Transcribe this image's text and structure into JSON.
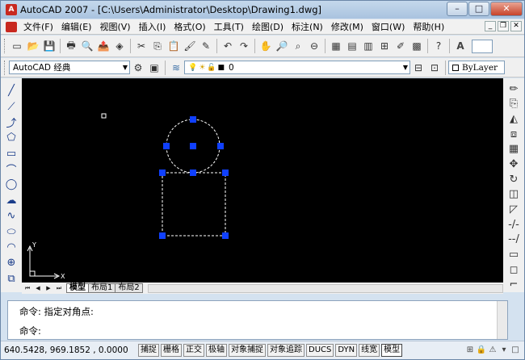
{
  "window": {
    "title": "AutoCAD 2007 - [C:\\Users\\Administrator\\Desktop\\Drawing1.dwg]",
    "app_icon": "autocad-logo-icon",
    "minimize": "–",
    "maximize": "□",
    "close": "✕"
  },
  "menu": {
    "items": [
      "文件(F)",
      "编辑(E)",
      "视图(V)",
      "插入(I)",
      "格式(O)",
      "工具(T)",
      "绘图(D)",
      "标注(N)",
      "修改(M)",
      "窗口(W)",
      "帮助(H)"
    ],
    "mdi_buttons": [
      "_",
      "❐",
      "✕"
    ]
  },
  "toolbar": {
    "standard_icons": [
      "new-icon",
      "open-icon",
      "save-icon",
      "plot-icon",
      "plot-preview-icon",
      "publish-icon",
      "3d-dwf-icon",
      "cut-icon",
      "copy-icon",
      "paste-icon",
      "match-properties-icon",
      "block-editor-icon",
      "undo-icon",
      "redo-icon",
      "pan-icon",
      "zoom-realtime-icon",
      "zoom-window-icon",
      "zoom-previous-icon",
      "properties-icon",
      "design-center-icon",
      "tool-palettes-icon",
      "sheet-set-icon",
      "markup-icon",
      "quickcalc-icon",
      "help-icon"
    ],
    "standard_glyphs": [
      "▭",
      "📂",
      "💾",
      "🖶",
      "🔍",
      "📤",
      "◈",
      "✂",
      "⎘",
      "📋",
      "🖌",
      "✎",
      "↶",
      "↷",
      "✋",
      "🔎",
      "⌕",
      "⊖",
      "▦",
      "▤",
      "▥",
      "⊞",
      "✐",
      "▩",
      "?"
    ],
    "text_style_glyph": "A"
  },
  "workspace": {
    "selected": "AutoCAD 经典",
    "gear_icons": [
      "⚙",
      "▣"
    ]
  },
  "layers": {
    "manager_icon": "layer-manager-icon",
    "state_glyphs": [
      "💡",
      "☀",
      "🔓",
      "■"
    ],
    "current": "0",
    "layer_prev": "◫",
    "layer_icons": [
      "⊟",
      "⊡"
    ]
  },
  "properties": {
    "color": "ByLayer"
  },
  "draw_toolbar": {
    "icons": [
      "line-icon",
      "construction-line-icon",
      "polyline-icon",
      "polygon-icon",
      "rectangle-icon",
      "arc-icon",
      "circle-icon",
      "revision-cloud-icon",
      "spline-icon",
      "ellipse-icon",
      "ellipse-arc-icon",
      "insert-block-icon",
      "make-block-icon"
    ],
    "glyphs": [
      "╱",
      "⟋",
      "⤴",
      "⬠",
      "▭",
      "⌒",
      "◯",
      "☁",
      "∿",
      "⬭",
      "◠",
      "⊕",
      "⧉"
    ]
  },
  "modify_toolbar": {
    "icons": [
      "erase-icon",
      "copy-object-icon",
      "mirror-icon",
      "offset-icon",
      "array-icon",
      "move-icon",
      "rotate-icon",
      "scale-icon",
      "stretch-icon",
      "trim-icon",
      "extend-icon",
      "break-icon",
      "chamfer-icon",
      "fillet-icon"
    ],
    "glyphs": [
      "✏",
      "⎘",
      "◭",
      "⧈",
      "▦",
      "✥",
      "↻",
      "◫",
      "◸",
      "-/-",
      "--/",
      "▭",
      "◻",
      "⌐"
    ]
  },
  "layout_tabs": {
    "nav": [
      "⏮",
      "◀",
      "▶",
      "⏭"
    ],
    "tabs": [
      "模型",
      "布局1",
      "布局2"
    ],
    "active_tab": "模型"
  },
  "command": {
    "lines": [
      "命令: 指定对角点:",
      "",
      "命令:"
    ]
  },
  "status": {
    "coords": "640.5428,  969.1852 , 0.0000",
    "toggles": [
      "捕捉",
      "栅格",
      "正交",
      "极轴",
      "对象捕捉",
      "对象追踪",
      "DUCS",
      "DYN",
      "线宽",
      "模型"
    ],
    "toggles_on": [
      "模型"
    ],
    "tray": [
      "⊞",
      "🔒",
      "⚠",
      "▾",
      "□"
    ]
  },
  "drawing": {
    "background": "#000000",
    "grip_color": "#1040ff",
    "dash_color": "#ffffff"
  }
}
